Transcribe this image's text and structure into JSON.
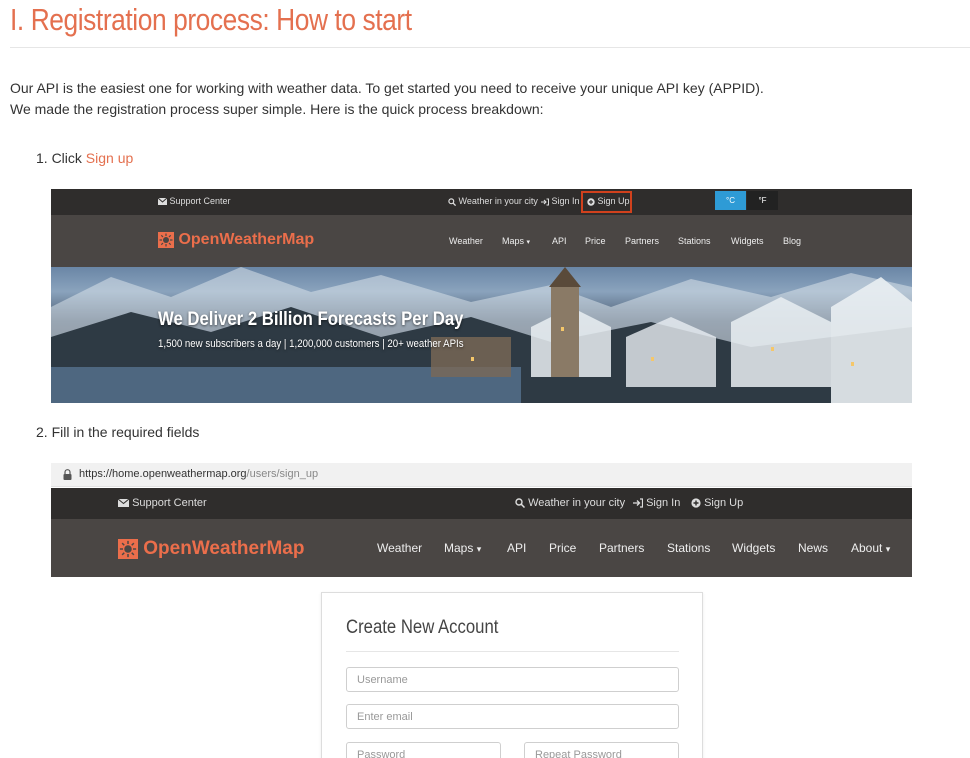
{
  "page": {
    "title": "I. Registration process: How to start",
    "intro_line1": "Our API is the easiest one for working with weather data. To get started you need to receive your unique API key (APPID).",
    "intro_line2": "We made the registration process super simple. Here is the quick process breakdown:",
    "step1_prefix": "1. Click ",
    "step1_link": "Sign up",
    "step2": "2. Fill in the required fields"
  },
  "shot1": {
    "support": "Support Center",
    "weather_city": "Weather in your city",
    "sign_in": "Sign In",
    "sign_up": "Sign Up",
    "unit_c": "°C",
    "unit_f": "°F",
    "logo": "OpenWeatherMap",
    "nav": [
      "Weather",
      "Maps",
      "API",
      "Price",
      "Partners",
      "Stations",
      "Widgets",
      "Blog"
    ],
    "hero_title": "We Deliver 2 Billion Forecasts Per Day",
    "hero_sub": "1,500 new subscribers a day | 1,200,000 customers | 20+ weather APIs"
  },
  "shot2": {
    "url_main": "https://home.openweathermap.org",
    "url_path": "/users/sign_up",
    "support": "Support Center",
    "weather_city": "Weather in your city",
    "sign_in": "Sign In",
    "sign_up": "Sign Up",
    "logo": "OpenWeatherMap",
    "nav": [
      "Weather",
      "Maps",
      "API",
      "Price",
      "Partners",
      "Stations",
      "Widgets",
      "News",
      "About"
    ],
    "form": {
      "title": "Create New Account",
      "username_placeholder": "Username",
      "email_placeholder": "Enter email",
      "password_placeholder": "Password",
      "repeat_password_placeholder": "Repeat Password"
    }
  },
  "colors": {
    "accent": "#e4704f",
    "nav_bg": "#4a4644",
    "topbar_bg": "#2f2d2c",
    "unit_active": "#2e9bd6",
    "highlight_box": "#d1411d"
  }
}
